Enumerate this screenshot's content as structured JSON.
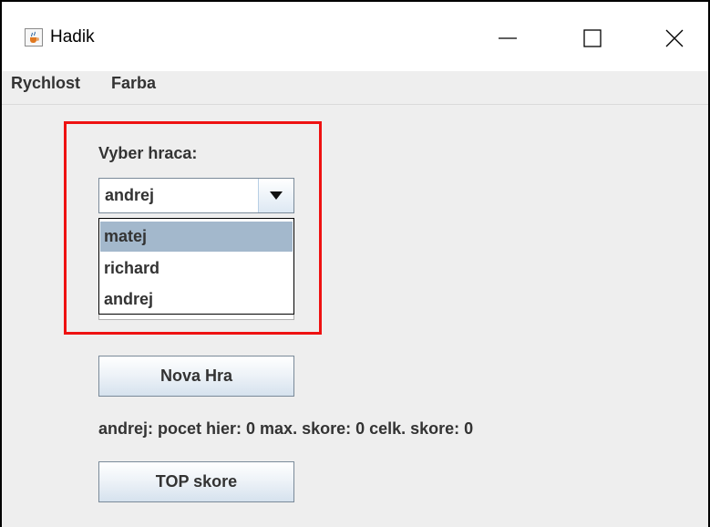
{
  "window": {
    "title": "Hadik",
    "icon": "java-cup-icon",
    "controls": [
      "minimize-icon",
      "maximize-icon",
      "close-icon"
    ]
  },
  "menu": {
    "items": [
      {
        "label": "Rychlost"
      },
      {
        "label": "Farba"
      }
    ]
  },
  "player_select": {
    "label": "Vyber hraca:",
    "selected": "andrej",
    "options": [
      {
        "label": "matej",
        "highlighted": true
      },
      {
        "label": "richard",
        "highlighted": false
      },
      {
        "label": "andrej",
        "highlighted": false
      }
    ]
  },
  "buttons": {
    "new_game": "Nova Hra",
    "top_score": "TOP skore"
  },
  "stats_text": "andrej: pocet hier: 0 max. skore: 0 celk. skore: 0",
  "colors": {
    "highlight_border": "#ee1111",
    "selected_option": "#a3b8cc"
  }
}
